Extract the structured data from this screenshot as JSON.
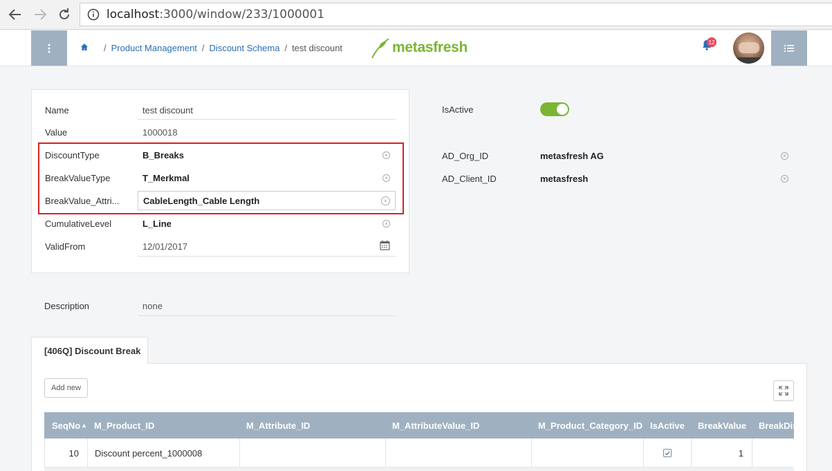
{
  "browser": {
    "url_host": "localhost",
    "url_path": ":3000/window/233/1000001"
  },
  "header": {
    "breadcrumb": [
      "Product Management",
      "Discount Schema",
      "test discount"
    ],
    "logo_text": "metasfresh",
    "notification_count": "12"
  },
  "form": {
    "name_label": "Name",
    "name_value": "test discount",
    "value_label": "Value",
    "value_value": "1000018",
    "discount_type_label": "DiscountType",
    "discount_type_value": "B_Breaks",
    "break_value_type_label": "BreakValueType",
    "break_value_type_value": "T_Merkmal",
    "break_value_attr_label": "BreakValue_Attri...",
    "break_value_attr_value": "CableLength_Cable Length",
    "cumulative_level_label": "CumulativeLevel",
    "cumulative_level_value": "L_Line",
    "valid_from_label": "ValidFrom",
    "valid_from_value": "12/01/2017",
    "is_active_label": "IsActive",
    "is_active": true,
    "org_label": "AD_Org_ID",
    "org_value": "metasfresh AG",
    "client_label": "AD_Client_ID",
    "client_value": "metasfresh",
    "description_label": "Description",
    "description_value": "none"
  },
  "tab": {
    "label": "[406Q] Discount Break",
    "add_new_label": "Add new"
  },
  "grid": {
    "columns": [
      "SeqNo",
      "M_Product_ID",
      "M_Attribute_ID",
      "M_AttributeValue_ID",
      "M_Product_Category_ID",
      "IsActive",
      "BreakValue",
      "BreakDis"
    ],
    "sort_indicator": "▲",
    "rows": [
      {
        "seqno": "10",
        "product": "Discount percent_1000008",
        "attribute": "",
        "attribute_value": "",
        "category": "",
        "is_active": true,
        "break_value": "1",
        "break_dis": ""
      }
    ]
  },
  "colors": {
    "accent": "#9fb1c1",
    "brand_green": "#7ab534",
    "highlight_red": "#d52323",
    "link_blue": "#2a6fb4"
  }
}
